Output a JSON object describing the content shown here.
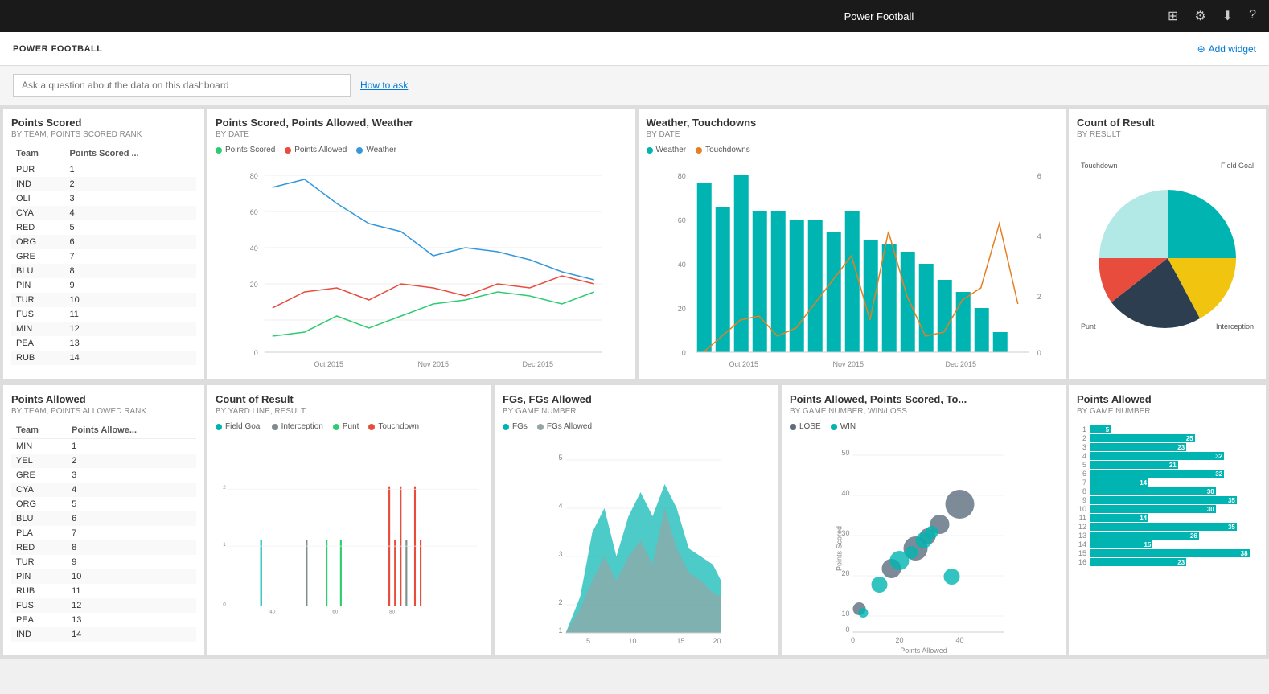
{
  "app": {
    "title": "Power Football",
    "subtitle": "POWER FOOTBALL",
    "add_widget": "Add widget"
  },
  "search": {
    "placeholder": "Ask a question about the data on this dashboard",
    "how_to_ask": "How to ask"
  },
  "widgets": {
    "points_scored": {
      "title": "Points Scored",
      "subtitle": "BY TEAM, POINTS SCORED RANK",
      "col_team": "Team",
      "col_points": "Points Scored ...",
      "rows": [
        {
          "team": "PUR",
          "pts": 1
        },
        {
          "team": "IND",
          "pts": 2
        },
        {
          "team": "OLI",
          "pts": 3
        },
        {
          "team": "CYA",
          "pts": 4
        },
        {
          "team": "RED",
          "pts": 5
        },
        {
          "team": "ORG",
          "pts": 6
        },
        {
          "team": "GRE",
          "pts": 7
        },
        {
          "team": "BLU",
          "pts": 8
        },
        {
          "team": "PIN",
          "pts": 9
        },
        {
          "team": "TUR",
          "pts": 10
        },
        {
          "team": "FUS",
          "pts": 11
        },
        {
          "team": "MIN",
          "pts": 12
        },
        {
          "team": "PEA",
          "pts": 13
        },
        {
          "team": "RUB",
          "pts": 14
        }
      ]
    },
    "points_scored_chart": {
      "title": "Points Scored, Points Allowed, Weather",
      "subtitle": "BY DATE",
      "legend": [
        "Points Scored",
        "Points Allowed",
        "Weather"
      ],
      "legend_colors": [
        "#2ecc71",
        "#e74c3c",
        "#3498db"
      ]
    },
    "weather_touchdowns": {
      "title": "Weather, Touchdowns",
      "subtitle": "BY DATE",
      "legend": [
        "Weather",
        "Touchdowns"
      ],
      "legend_colors": [
        "#00b5b1",
        "#e67e22"
      ]
    },
    "count_result_pie": {
      "title": "Count of Result",
      "subtitle": "BY RESULT",
      "legend": [
        "Touchdown",
        "Field Goal",
        "Punt",
        "Interception"
      ],
      "legend_colors": [
        "#f1c40f",
        "#00b5b1",
        "#2c3e50",
        "#e74c3c"
      ]
    },
    "points_allowed": {
      "title": "Points Allowed",
      "subtitle": "BY TEAM, POINTS ALLOWED RANK",
      "col_team": "Team",
      "col_points": "Points Allowe...",
      "rows": [
        {
          "team": "MIN",
          "pts": 1
        },
        {
          "team": "YEL",
          "pts": 2
        },
        {
          "team": "GRE",
          "pts": 3
        },
        {
          "team": "CYA",
          "pts": 4
        },
        {
          "team": "ORG",
          "pts": 5
        },
        {
          "team": "BLU",
          "pts": 6
        },
        {
          "team": "PLA",
          "pts": 7
        },
        {
          "team": "RED",
          "pts": 8
        },
        {
          "team": "TUR",
          "pts": 9
        },
        {
          "team": "PIN",
          "pts": 10
        },
        {
          "team": "RUB",
          "pts": 11
        },
        {
          "team": "FUS",
          "pts": 12
        },
        {
          "team": "PEA",
          "pts": 13
        },
        {
          "team": "IND",
          "pts": 14
        }
      ]
    },
    "count_result_bar": {
      "title": "Count of Result",
      "subtitle": "BY YARD LINE, RESULT",
      "legend": [
        "Field Goal",
        "Interception",
        "Punt",
        "Touchdown"
      ],
      "legend_colors": [
        "#00b5b1",
        "#7f8c8d",
        "#2ecc71",
        "#e74c3c"
      ]
    },
    "fgs_allowed": {
      "title": "FGs, FGs Allowed",
      "subtitle": "BY GAME NUMBER",
      "legend": [
        "FGs",
        "FGs Allowed"
      ],
      "legend_colors": [
        "#00b5b1",
        "#95a5a6"
      ]
    },
    "points_scatter": {
      "title": "Points Allowed, Points Scored, To...",
      "subtitle": "BY GAME NUMBER, WIN/LOSS",
      "legend": [
        "LOSE",
        "WIN"
      ],
      "legend_colors": [
        "#5d6d7e",
        "#00b5b1"
      ]
    },
    "points_allowed_bar": {
      "title": "Points Allowed",
      "subtitle": "BY GAME NUMBER",
      "bars": [
        {
          "num": 1,
          "val": 5
        },
        {
          "num": 2,
          "val": 25
        },
        {
          "num": 3,
          "val": 23
        },
        {
          "num": 4,
          "val": 32
        },
        {
          "num": 5,
          "val": 21
        },
        {
          "num": 6,
          "val": 32
        },
        {
          "num": 7,
          "val": 14
        },
        {
          "num": 8,
          "val": 30
        },
        {
          "num": 9,
          "val": 35
        },
        {
          "num": 10,
          "val": 30
        },
        {
          "num": 11,
          "val": 14
        },
        {
          "num": 12,
          "val": 35
        },
        {
          "num": 13,
          "val": 26
        },
        {
          "num": 14,
          "val": 15
        },
        {
          "num": 15,
          "val": 38
        },
        {
          "num": 16,
          "val": 23
        }
      ],
      "max_val": 40
    }
  }
}
